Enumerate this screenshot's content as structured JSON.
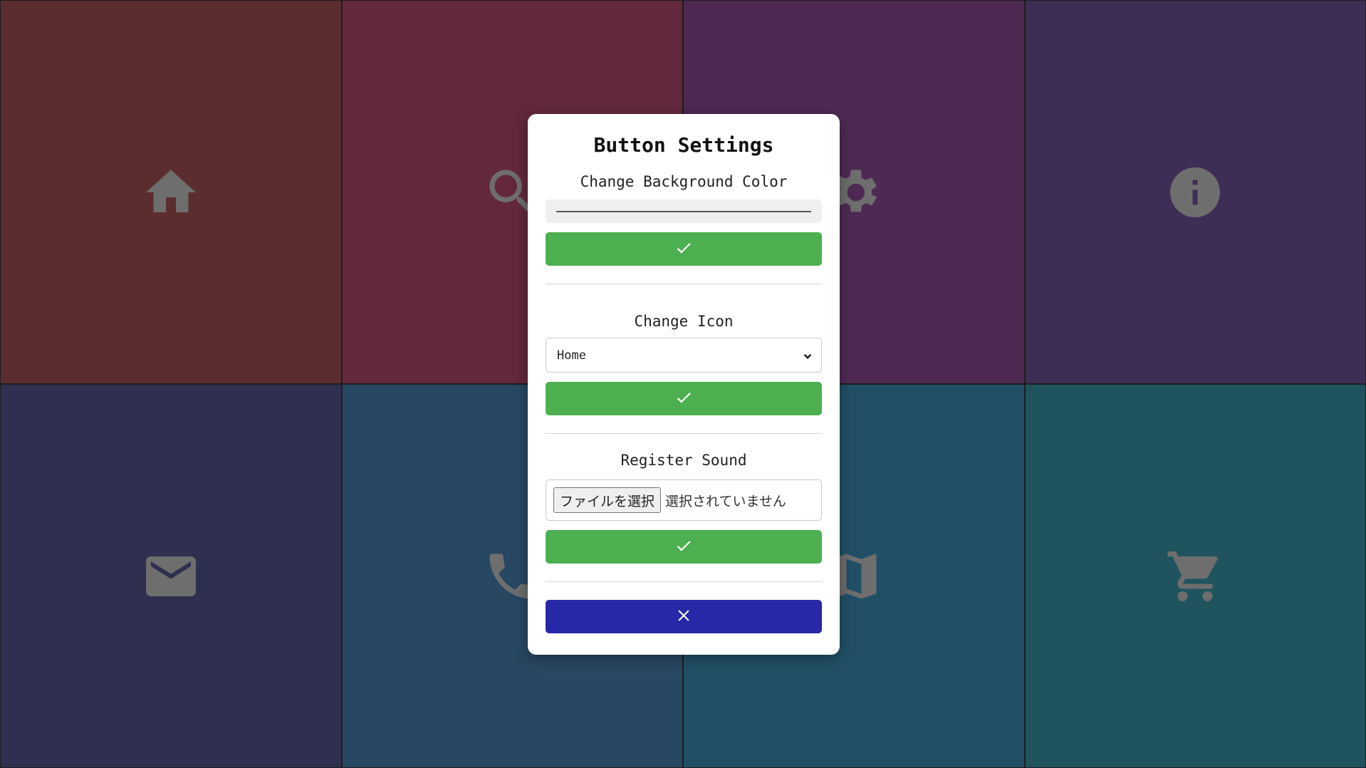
{
  "tiles": [
    {
      "name": "home",
      "color": "#5c2d2e",
      "icon": "home-icon"
    },
    {
      "name": "search",
      "color": "#63283e",
      "icon": "search-icon"
    },
    {
      "name": "settings",
      "color": "#4e2a53",
      "icon": "gear-icon"
    },
    {
      "name": "info",
      "color": "#3e2d55",
      "icon": "info-icon"
    },
    {
      "name": "mail",
      "color": "#2f304f",
      "icon": "mail-icon"
    },
    {
      "name": "phone",
      "color": "#284762",
      "icon": "phone-icon"
    },
    {
      "name": "map",
      "color": "#214f66",
      "icon": "map-icon"
    },
    {
      "name": "cart",
      "color": "#1f545f",
      "icon": "cart-icon"
    }
  ],
  "modal": {
    "title": "Button Settings",
    "background_section": {
      "label": "Change Background Color",
      "confirm_icon": "check-icon"
    },
    "icon_section": {
      "label": "Change Icon",
      "selected": "Home",
      "confirm_icon": "check-icon"
    },
    "sound_section": {
      "label": "Register Sound",
      "file_button": "ファイルを選択",
      "file_status": "選択されていません",
      "confirm_icon": "check-icon"
    },
    "close_icon": "close-icon"
  },
  "colors": {
    "confirm": "#4caf50",
    "close": "#2727a7"
  }
}
